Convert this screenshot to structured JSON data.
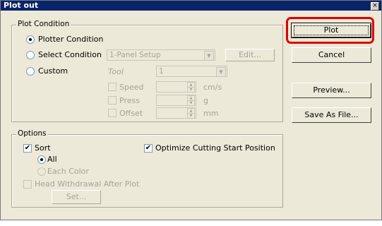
{
  "window": {
    "title": "Plot out",
    "close_glyph": "×"
  },
  "plot_condition": {
    "label": "Plot Condition",
    "plotter_condition": "Plotter Condition",
    "select_condition": "Select Condition",
    "select_value": "1-Panel Setup",
    "edit_button": "Edit...",
    "custom": "Custom",
    "tool_label": "Tool",
    "tool_value": "1",
    "speed_label": "Speed",
    "speed_unit": "cm/s",
    "press_label": "Press",
    "press_unit": "g",
    "offset_label": "Offset",
    "offset_unit": "mm"
  },
  "buttons": {
    "plot": "Plot",
    "cancel": "Cancel",
    "preview": "Preview...",
    "save_as_file": "Save As File..."
  },
  "options": {
    "label": "Options",
    "sort": "Sort",
    "all": "All",
    "each_color": "Each Color",
    "optimize": "Optimize Cutting Start Position",
    "head_withdrawal": "Head Withdrawal After Plot",
    "set_button": "Set..."
  },
  "state": {
    "selected_condition": "Plotter Condition",
    "sort_checked": true,
    "sort_mode": "All",
    "optimize_checked": true,
    "head_withdrawal_checked": false
  },
  "colors": {
    "title_bar": "#0a246a",
    "dialog_bg": "#ece9d8",
    "highlight": "#e00000"
  },
  "icons": {
    "check": "✔",
    "dropdown": "▼",
    "spin_up": "▲",
    "spin_down": "▼"
  }
}
